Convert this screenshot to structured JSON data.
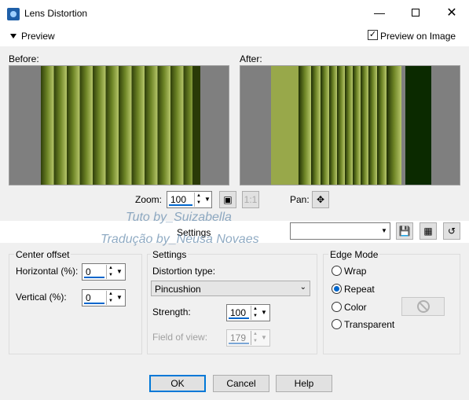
{
  "window": {
    "title": "Lens Distortion",
    "min_icon": "minimize-icon",
    "max_icon": "maximize-icon",
    "close_icon": "close-icon"
  },
  "preview": {
    "toggle_label": "Preview",
    "preview_on_image_label": "Preview on Image",
    "preview_on_image_checked": true
  },
  "before": {
    "label": "Before:"
  },
  "after": {
    "label": "After:"
  },
  "zoom": {
    "label": "Zoom:",
    "value": "100"
  },
  "pan": {
    "label": "Pan:"
  },
  "settings_bar": {
    "label": "Settings",
    "preset_value": ""
  },
  "watermark": {
    "line1": "Tuto by_Suizabella",
    "line2": "Tradução by_Neusa Novaes"
  },
  "center_offset": {
    "title": "Center offset",
    "horizontal_label": "Horizontal (%):",
    "horizontal_value": "0",
    "vertical_label": "Vertical (%):",
    "vertical_value": "0"
  },
  "settings": {
    "title": "Settings",
    "distortion_type_label": "Distortion type:",
    "distortion_type_value": "Pincushion",
    "strength_label": "Strength:",
    "strength_value": "100",
    "fov_label": "Field of view:",
    "fov_value": "179"
  },
  "edge_mode": {
    "title": "Edge Mode",
    "options": [
      "Wrap",
      "Repeat",
      "Color",
      "Transparent"
    ],
    "selected": "Repeat"
  },
  "buttons": {
    "ok": "OK",
    "cancel": "Cancel",
    "help": "Help"
  },
  "colors": {
    "green_light": "#98a84a",
    "green_dark": "#2f3f0a",
    "accent": "#0066cc",
    "after_dark": "#0b2a00"
  }
}
